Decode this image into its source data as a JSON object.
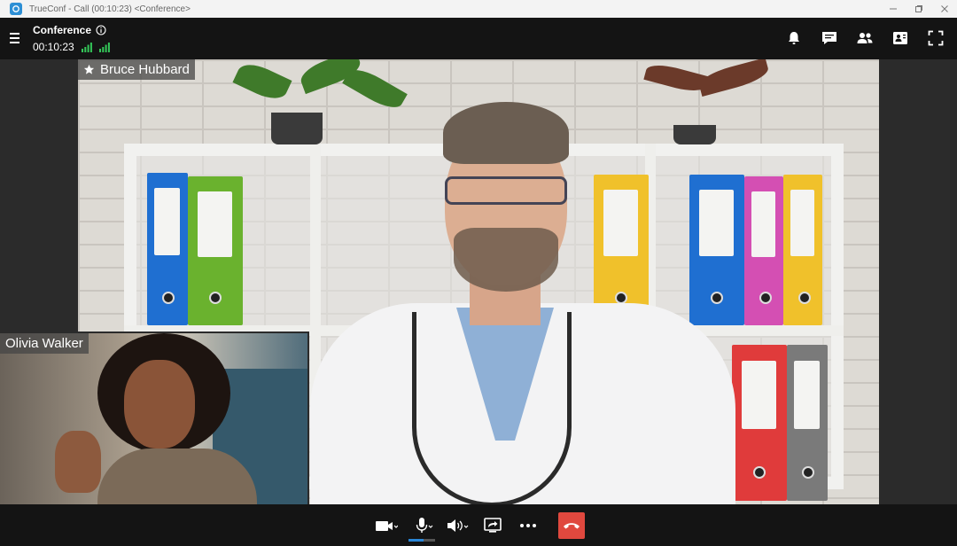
{
  "window": {
    "title": "TrueConf - Call (00:10:23) <Conference>"
  },
  "header": {
    "conference_title": "Conference",
    "call_timer": "00:10:23",
    "actions": [
      "bell-icon",
      "chat-icon",
      "participants-icon",
      "layout-icon",
      "fullscreen-icon"
    ]
  },
  "participants": {
    "main": {
      "name": "Bruce Hubbard",
      "role_icon": "star-icon"
    },
    "pip": {
      "name": "Olivia Walker"
    }
  },
  "toolbar": {
    "buttons": [
      "camera-icon",
      "microphone-icon",
      "speaker-icon",
      "screen-share-icon",
      "more-icon",
      "hang-up-icon"
    ],
    "mic_level": 0.55,
    "hangup_color": "#e0483e",
    "accent_color": "#2a86d7",
    "signal_color": "#34c759"
  }
}
